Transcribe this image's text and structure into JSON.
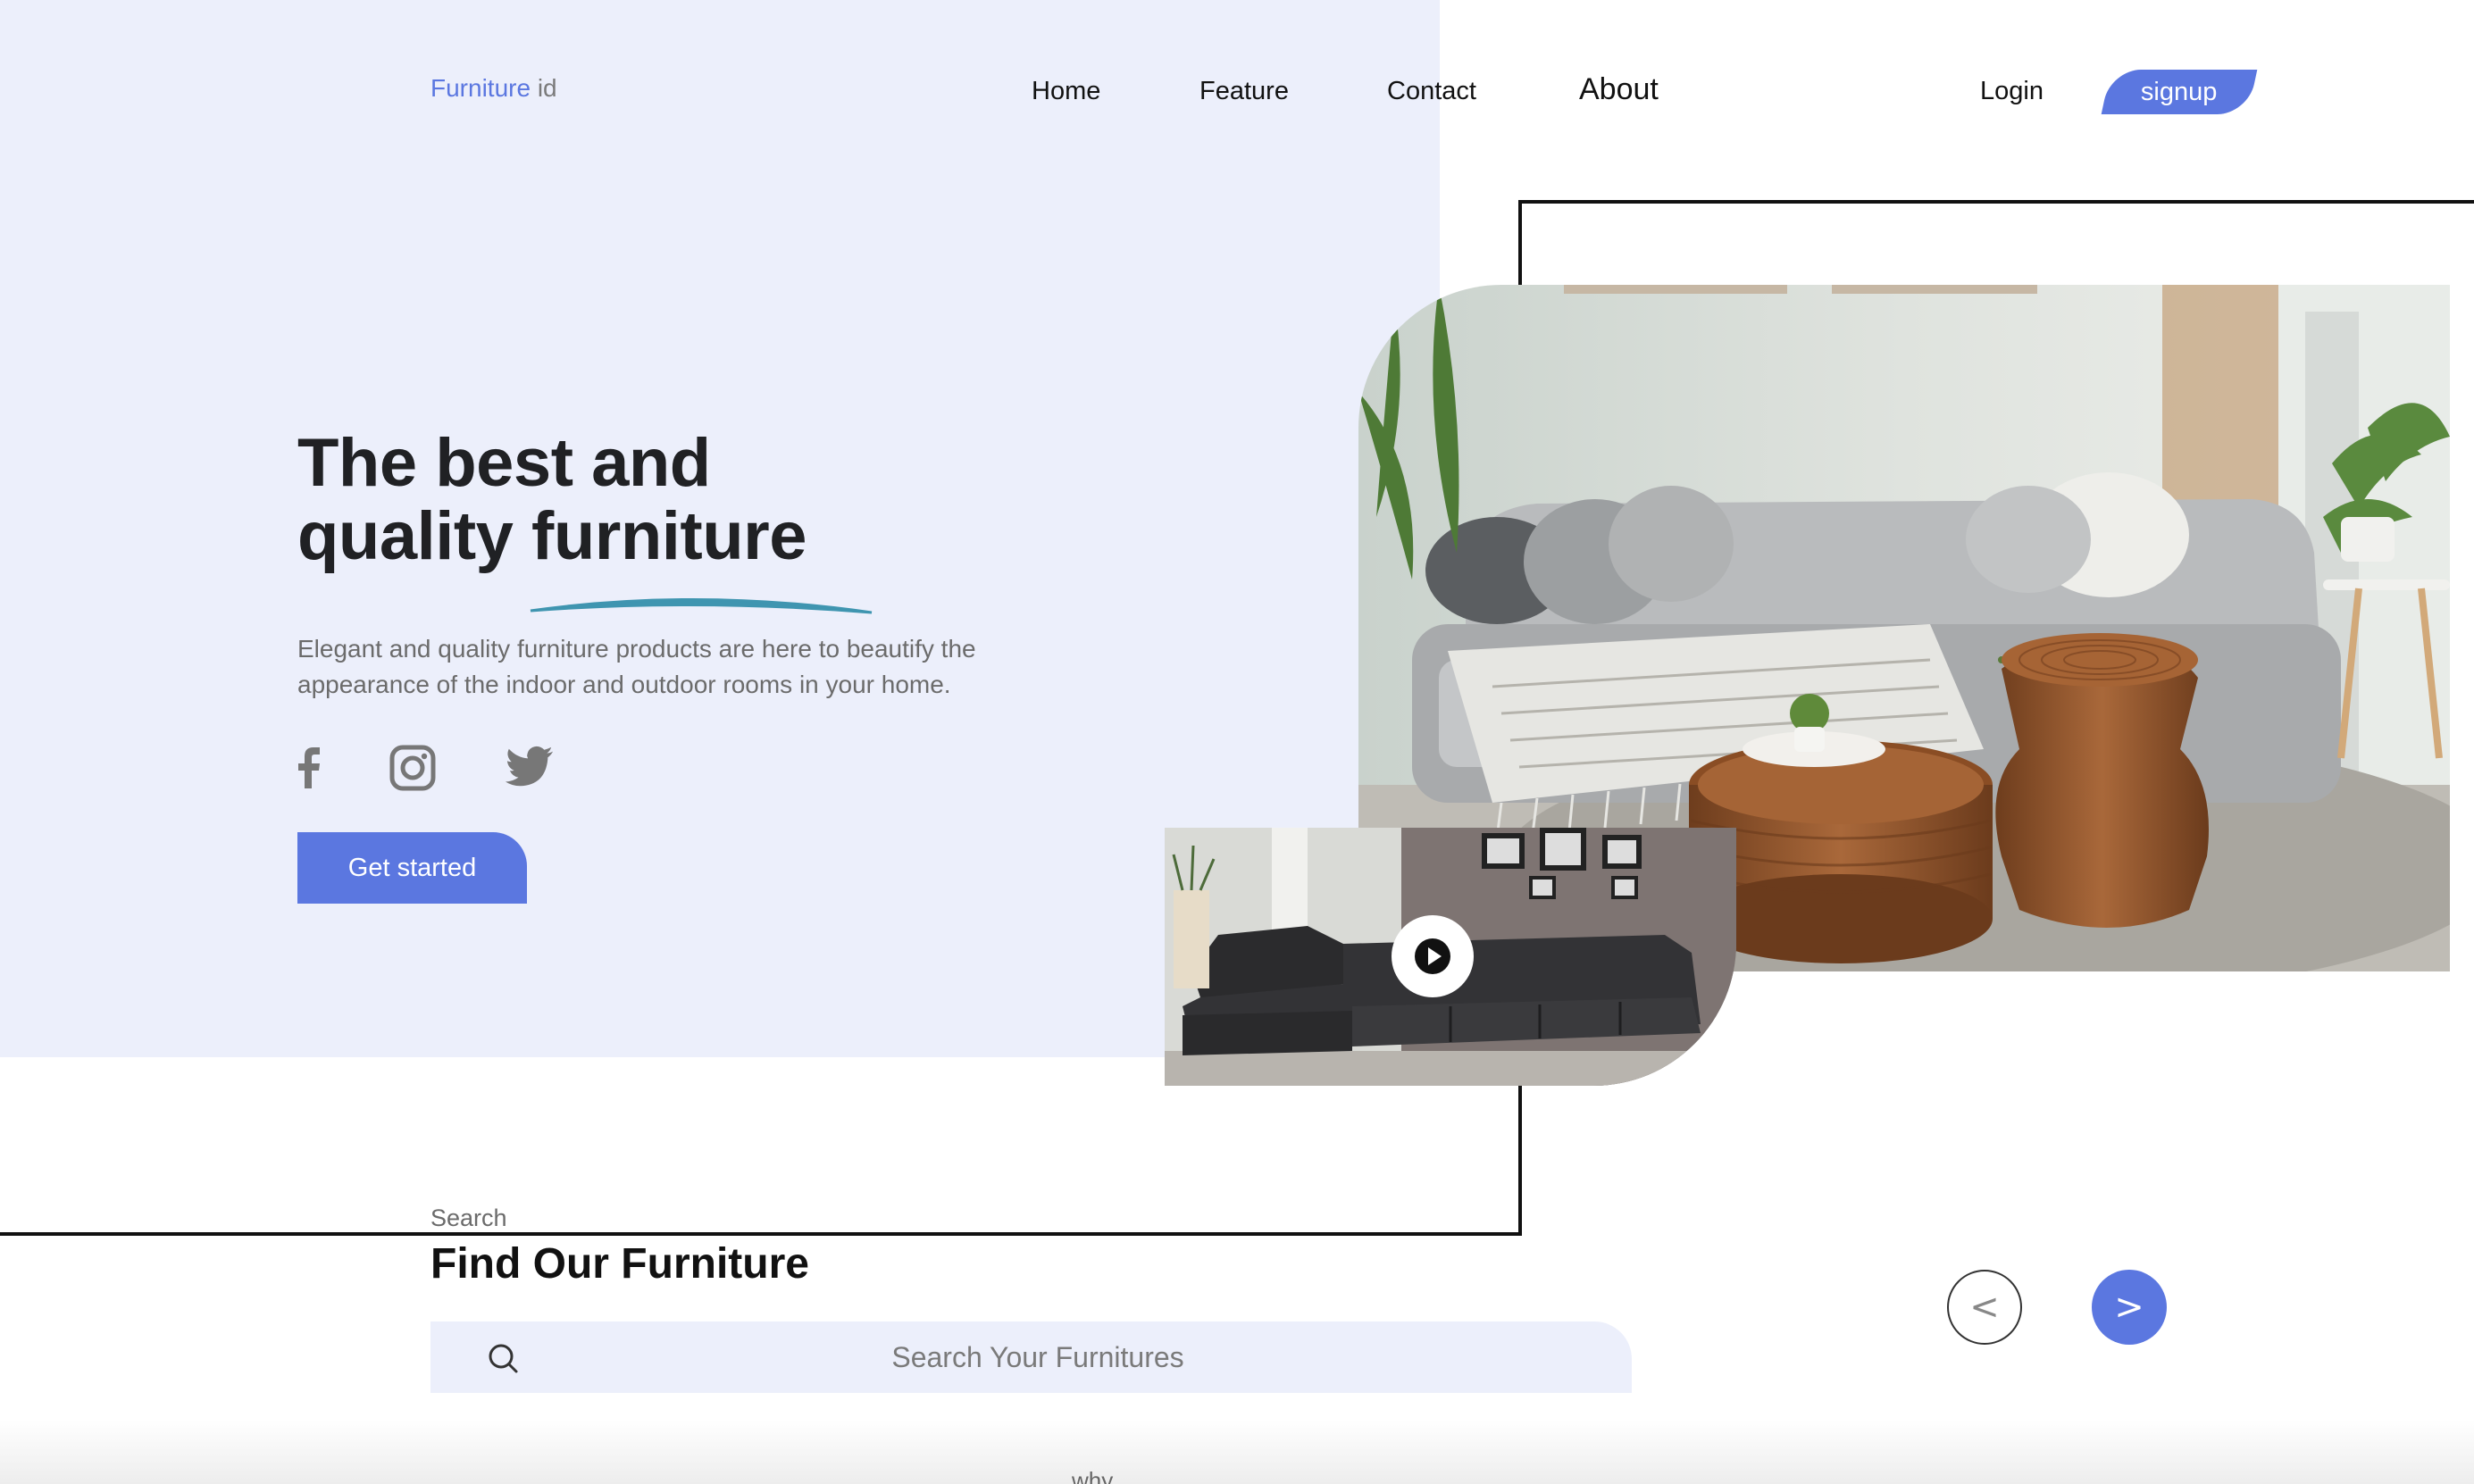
{
  "header": {
    "logo_brand": "Furniture",
    "logo_suffix": "id",
    "nav": {
      "home": "Home",
      "feature": "Feature",
      "contact": "Contact",
      "about": "About"
    },
    "login": "Login",
    "signup": "signup"
  },
  "hero": {
    "title_line1": "The best and",
    "title_line2": "quality furniture",
    "description": "Elegant and quality furniture products are here to beautify the appearance of the indoor and outdoor rooms in your home.",
    "cta": "Get started",
    "social": [
      "facebook-icon",
      "instagram-icon",
      "twitter-icon"
    ]
  },
  "search": {
    "kicker": "Search",
    "title": "Find Our Furniture",
    "placeholder": "Search Your Furnitures"
  },
  "carousel": {
    "prev": "<",
    "next": ">"
  },
  "next_section": {
    "kicker": "why"
  },
  "colors": {
    "accent": "#5b77e0",
    "hero_bg": "#eceffb",
    "swoosh": "#3f95b0"
  }
}
